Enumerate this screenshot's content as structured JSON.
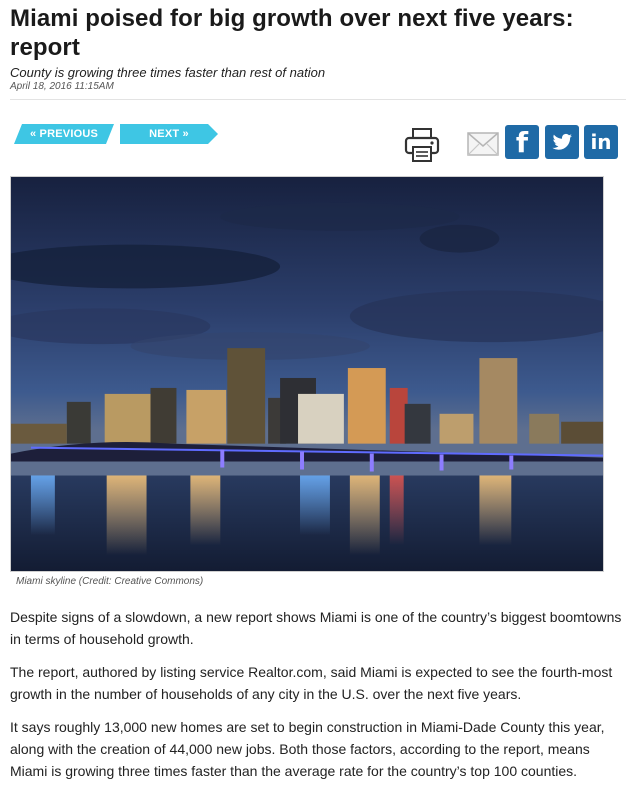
{
  "article": {
    "headline": "Miami poised for big growth over next five years: report",
    "subhead": "County is growing three times faster than rest of nation",
    "date": "April 18, 2016 11:15AM"
  },
  "nav": {
    "prev_label": "« PREVIOUS",
    "next_label": "NEXT »"
  },
  "share": {
    "icons": [
      "print-icon",
      "mail-icon",
      "facebook-icon",
      "twitter-icon",
      "linkedin-icon"
    ],
    "facebook_glyph": "f",
    "linkedin_glyph": "in",
    "brand_color": "#1f6aa6",
    "button_color": "#3ec6e4"
  },
  "image": {
    "caption": "Miami skyline (Credit: Creative Commons)"
  },
  "body": {
    "paragraphs": [
      "Despite signs of a slowdown, a new report shows Miami is one of the country’s biggest boomtowns in terms of household growth.",
      "The report, authored by listing service Realtor.com, said Miami is expected to see the fourth-most growth in the number of households of any city in the U.S. over the next five years.",
      "It says roughly 13,000 new homes are set to begin construction in Miami-Dade County this year, along with the creation of 44,000 new jobs. Both those factors, according to the report, means Miami is growing three times faster than the average rate for the country’s top 100 counties."
    ]
  }
}
